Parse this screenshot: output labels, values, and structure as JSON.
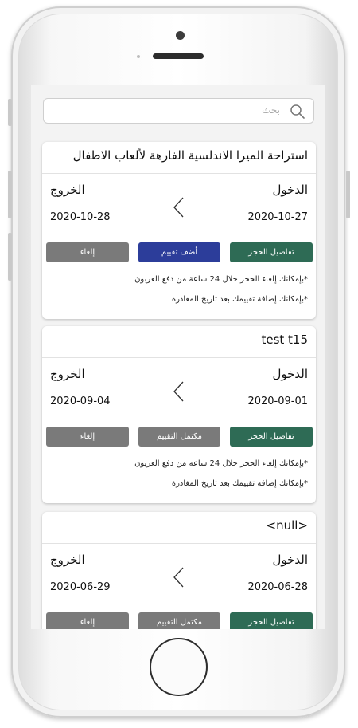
{
  "search": {
    "placeholder": "بحث"
  },
  "bookings": [
    {
      "title": "استراحة الميرا الاندلسية الفارهة لألعاب الاطفال",
      "checkin_label": "الدخول",
      "checkin_date": "2020-10-27",
      "checkout_label": "الخروج",
      "checkout_date": "2020-10-28",
      "details_label": "تفاصيل الحجز",
      "rating_label": "أضف تقييم",
      "cancel_label": "إلغاء",
      "note_cancel": "*بإمكانك إلغاء الحجز خلال 24 ساعة من دفع العربون",
      "note_rating": "*بإمكانك إضافة تقييمك بعد تاريخ المغادرة"
    },
    {
      "title": "test t15",
      "checkin_label": "الدخول",
      "checkin_date": "2020-09-01",
      "checkout_label": "الخروج",
      "checkout_date": "2020-09-04",
      "details_label": "تفاصيل الحجز",
      "rating_label": "مكتمل التقييم",
      "cancel_label": "إلغاء",
      "note_cancel": "*بإمكانك إلغاء الحجز خلال 24 ساعة من دفع العربون",
      "note_rating": "*بإمكانك إضافة تقييمك بعد تاريخ المغادرة"
    },
    {
      "title": "<null>",
      "checkin_label": "الدخول",
      "checkin_date": "2020-06-28",
      "checkout_label": "الخروج",
      "checkout_date": "2020-06-29",
      "details_label": "تفاصيل الحجز",
      "rating_label": "مكتمل التقييم",
      "cancel_label": "إلغاء"
    }
  ],
  "colors": {
    "details": "#2e6b55",
    "rate": "#2c3d9a",
    "disabled": "#7a7a7a"
  },
  "icons": {
    "search": "search-icon",
    "arrow": "chevron-left-icon"
  }
}
